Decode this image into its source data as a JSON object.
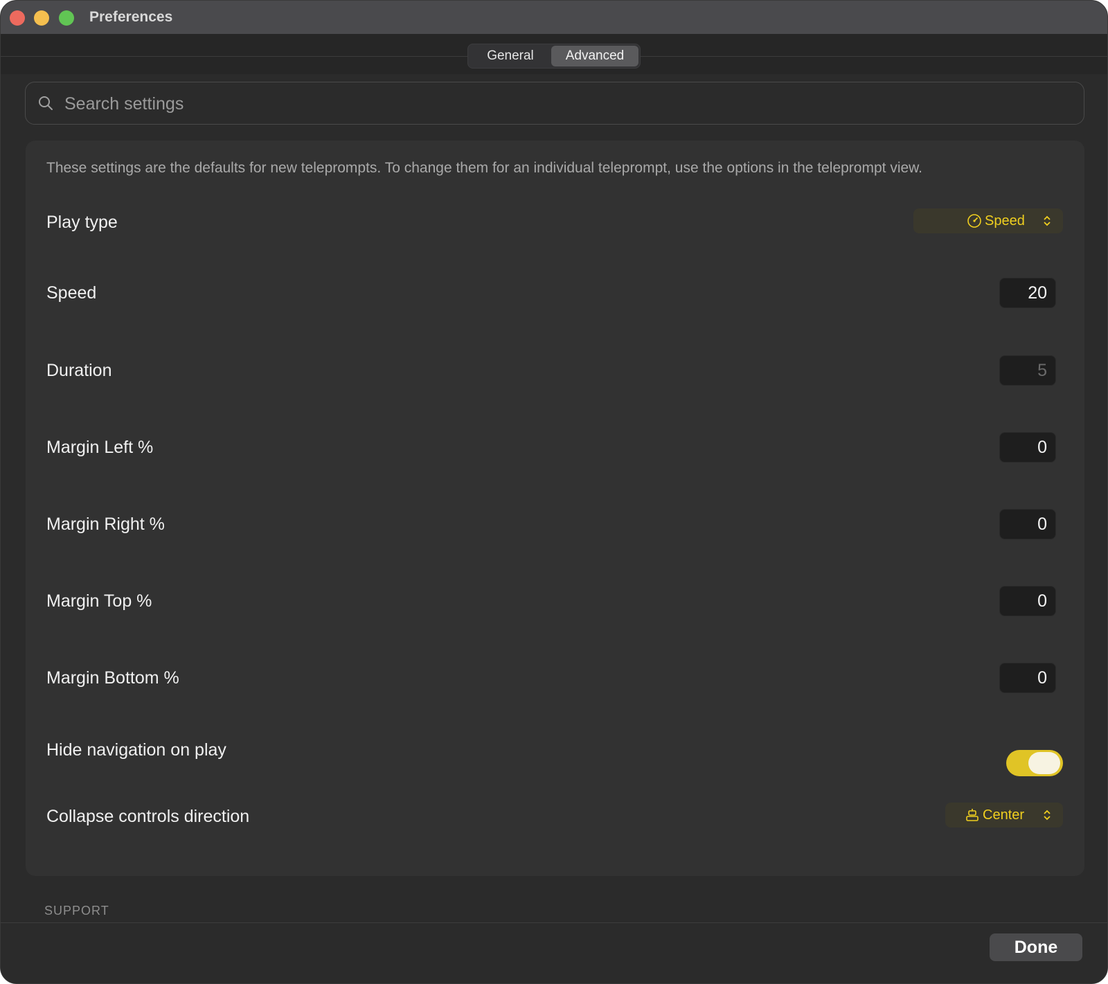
{
  "window": {
    "title": "Preferences"
  },
  "tabs": [
    {
      "label": "General",
      "selected": false
    },
    {
      "label": "Advanced",
      "selected": true
    }
  ],
  "search": {
    "placeholder": "Search settings",
    "value": ""
  },
  "settings": {
    "description": "These settings are the defaults for new teleprompts. To change them for an individual teleprompt, use the options in the teleprompt view.",
    "play_type": {
      "label": "Play type",
      "value": "Speed",
      "icon": "speedometer-icon"
    },
    "speed": {
      "label": "Speed",
      "value": "20"
    },
    "duration": {
      "label": "Duration",
      "value": "5",
      "disabled": true
    },
    "margin_left": {
      "label": "Margin Left %",
      "value": "0"
    },
    "margin_right": {
      "label": "Margin Right %",
      "value": "0"
    },
    "margin_top": {
      "label": "Margin Top %",
      "value": "0"
    },
    "margin_bottom": {
      "label": "Margin Bottom %",
      "value": "0"
    },
    "hide_navigation": {
      "label": "Hide navigation on play",
      "on": true
    },
    "collapse_direction": {
      "label": "Collapse controls direction",
      "value": "Center",
      "icon": "align-center-icon"
    }
  },
  "sections": {
    "support": "SUPPORT"
  },
  "footer": {
    "done_label": "Done"
  },
  "colors": {
    "accent": "#f0cf1f",
    "toggle_on": "#e0c426",
    "background": "#2b2b2b",
    "card": "#323232"
  }
}
